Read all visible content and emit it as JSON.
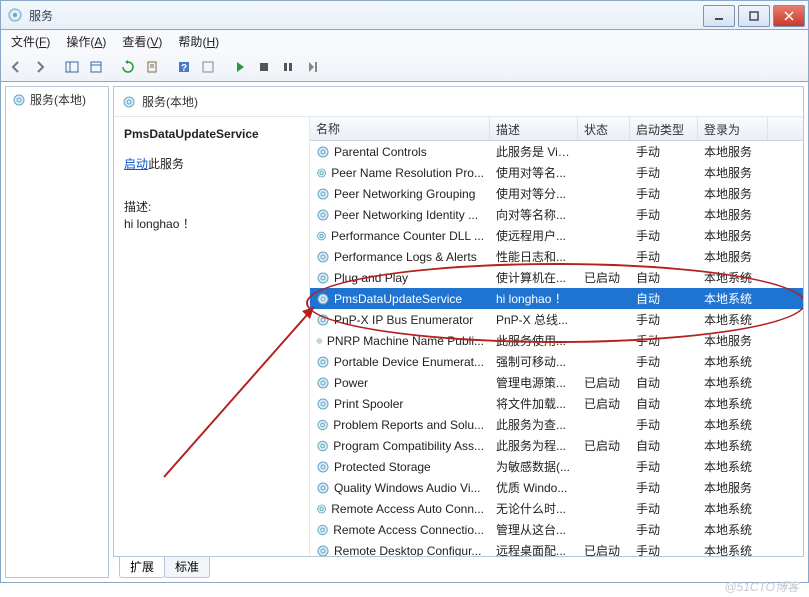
{
  "window": {
    "title": "服务"
  },
  "menus": {
    "file": {
      "label": "文件",
      "accel": "F"
    },
    "action": {
      "label": "操作",
      "accel": "A"
    },
    "view": {
      "label": "查看",
      "accel": "V"
    },
    "help": {
      "label": "帮助",
      "accel": "H"
    }
  },
  "left_tree": {
    "root": "服务(本地)"
  },
  "right_header": "服务(本地)",
  "detail": {
    "name": "PmsDataUpdateService",
    "start_link": "启动",
    "start_suffix": "此服务",
    "desc_label": "描述:",
    "desc_value": "hi longhao ！"
  },
  "columns": {
    "name": "名称",
    "desc": "描述",
    "status": "状态",
    "startup": "启动类型",
    "logon": "登录为"
  },
  "tabs": {
    "extended": "扩展",
    "standard": "标准"
  },
  "selected_index": 7,
  "services": [
    {
      "name": "Parental Controls",
      "desc": "此服务是 Vis...",
      "status": "",
      "startup": "手动",
      "logon": "本地服务"
    },
    {
      "name": "Peer Name Resolution Pro...",
      "desc": "使用对等名...",
      "status": "",
      "startup": "手动",
      "logon": "本地服务"
    },
    {
      "name": "Peer Networking Grouping",
      "desc": "使用对等分...",
      "status": "",
      "startup": "手动",
      "logon": "本地服务"
    },
    {
      "name": "Peer Networking Identity ...",
      "desc": "向对等名称...",
      "status": "",
      "startup": "手动",
      "logon": "本地服务"
    },
    {
      "name": "Performance Counter DLL ...",
      "desc": "使远程用户...",
      "status": "",
      "startup": "手动",
      "logon": "本地服务"
    },
    {
      "name": "Performance Logs & Alerts",
      "desc": "性能日志和...",
      "status": "",
      "startup": "手动",
      "logon": "本地服务"
    },
    {
      "name": "Plug and Play",
      "desc": "使计算机在...",
      "status": "已启动",
      "startup": "自动",
      "logon": "本地系统"
    },
    {
      "name": "PmsDataUpdateService",
      "desc": "hi longhao ！",
      "status": "",
      "startup": "自动",
      "logon": "本地系统"
    },
    {
      "name": "PnP-X IP Bus Enumerator",
      "desc": "PnP-X 总线...",
      "status": "",
      "startup": "手动",
      "logon": "本地系统"
    },
    {
      "name": "PNRP Machine Name Publi...",
      "desc": "此服务使用...",
      "status": "",
      "startup": "手动",
      "logon": "本地服务"
    },
    {
      "name": "Portable Device Enumerat...",
      "desc": "强制可移动...",
      "status": "",
      "startup": "手动",
      "logon": "本地系统"
    },
    {
      "name": "Power",
      "desc": "管理电源策...",
      "status": "已启动",
      "startup": "自动",
      "logon": "本地系统"
    },
    {
      "name": "Print Spooler",
      "desc": "将文件加载...",
      "status": "已启动",
      "startup": "自动",
      "logon": "本地系统"
    },
    {
      "name": "Problem Reports and Solu...",
      "desc": "此服务为查...",
      "status": "",
      "startup": "手动",
      "logon": "本地系统"
    },
    {
      "name": "Program Compatibility Ass...",
      "desc": "此服务为程...",
      "status": "已启动",
      "startup": "自动",
      "logon": "本地系统"
    },
    {
      "name": "Protected Storage",
      "desc": "为敏感数据(...",
      "status": "",
      "startup": "手动",
      "logon": "本地系统"
    },
    {
      "name": "Quality Windows Audio Vi...",
      "desc": "优质 Windo...",
      "status": "",
      "startup": "手动",
      "logon": "本地服务"
    },
    {
      "name": "Remote Access Auto Conn...",
      "desc": "无论什么时...",
      "status": "",
      "startup": "手动",
      "logon": "本地系统"
    },
    {
      "name": "Remote Access Connectio...",
      "desc": "管理从这台...",
      "status": "",
      "startup": "手动",
      "logon": "本地系统"
    },
    {
      "name": "Remote Desktop Configur...",
      "desc": "远程桌面配...",
      "status": "已启动",
      "startup": "手动",
      "logon": "本地系统"
    }
  ],
  "watermark": "@51CTO博客"
}
